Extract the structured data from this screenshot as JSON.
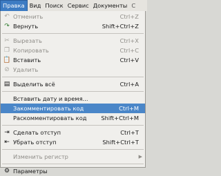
{
  "menubar": {
    "items": [
      "Правка",
      "Вид",
      "Поиск",
      "Сервис",
      "Документы",
      "С"
    ]
  },
  "menu": {
    "undo": {
      "label": "Отменить",
      "shortcut": "Ctrl+Z"
    },
    "redo": {
      "label": "Вернуть",
      "shortcut": "Shift+Ctrl+Z"
    },
    "cut": {
      "label": "Вырезать",
      "shortcut": "Ctrl+X"
    },
    "copy": {
      "label": "Копировать",
      "shortcut": "Ctrl+C"
    },
    "paste": {
      "label": "Вставить",
      "shortcut": "Ctrl+V"
    },
    "delete": {
      "label": "Удалить",
      "shortcut": ""
    },
    "select_all": {
      "label": "Выделить всё",
      "shortcut": "Ctrl+A"
    },
    "insert_date": {
      "label": "Вставить дату и время...",
      "shortcut": ""
    },
    "comment": {
      "label": "Закомментировать код",
      "shortcut": "Ctrl+M"
    },
    "uncomment": {
      "label": "Раскомментировать код",
      "shortcut": "Shift+Ctrl+M"
    },
    "indent": {
      "label": "Сделать отступ",
      "shortcut": "Ctrl+T"
    },
    "unindent": {
      "label": "Убрать отступ",
      "shortcut": "Shift+Ctrl+T"
    },
    "change_case": {
      "label": "Изменить регистр",
      "shortcut": ""
    },
    "preferences": {
      "label": "Параметры",
      "shortcut": ""
    }
  }
}
